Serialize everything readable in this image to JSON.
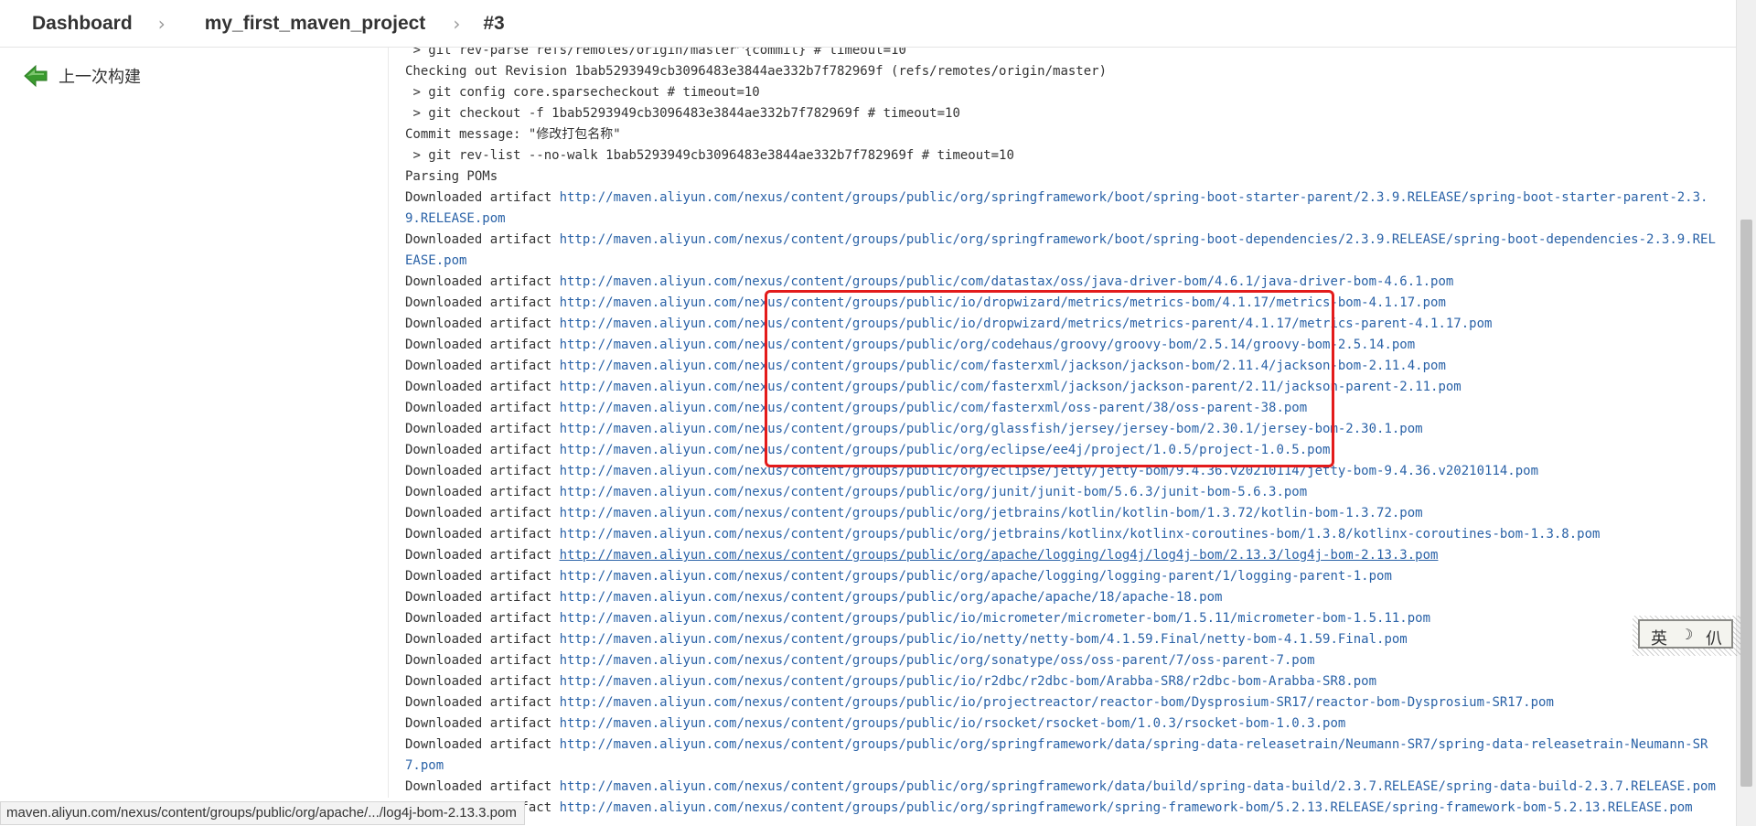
{
  "breadcrumbs": {
    "dashboard": "Dashboard",
    "project": "my_first_maven_project",
    "build": "#3",
    "separator": "›"
  },
  "sidebar": {
    "previous_build": "上一次构建",
    "previous_build_icon": "green-back-arrow"
  },
  "console": {
    "artifact_prefix": "Downloaded artifact ",
    "lines": [
      {
        "text": " > git rev-parse refs/remotes/origin/master^{commit} # timeout=10"
      },
      {
        "text": "Checking out Revision 1bab5293949cb3096483e3844ae332b7f782969f (refs/remotes/origin/master)"
      },
      {
        "text": " > git config core.sparsecheckout # timeout=10"
      },
      {
        "text": " > git checkout -f 1bab5293949cb3096483e3844ae332b7f782969f # timeout=10"
      },
      {
        "text": "Commit message: \"修改打包名称\""
      },
      {
        "text": " > git rev-list --no-walk 1bab5293949cb3096483e3844ae332b7f782969f # timeout=10"
      },
      {
        "text": "Parsing POMs"
      },
      {
        "url": "http://maven.aliyun.com/nexus/content/groups/public/org/springframework/boot/spring-boot-starter-parent/2.3.9.RELEASE/spring-boot-starter-parent-2.3.9.RELEASE.pom"
      },
      {
        "url": "http://maven.aliyun.com/nexus/content/groups/public/org/springframework/boot/spring-boot-dependencies/2.3.9.RELEASE/spring-boot-dependencies-2.3.9.RELEASE.pom"
      },
      {
        "url": "http://maven.aliyun.com/nexus/content/groups/public/com/datastax/oss/java-driver-bom/4.6.1/java-driver-bom-4.6.1.pom"
      },
      {
        "url": "http://maven.aliyun.com/nexus/content/groups/public/io/dropwizard/metrics/metrics-bom/4.1.17/metrics-bom-4.1.17.pom"
      },
      {
        "url": "http://maven.aliyun.com/nexus/content/groups/public/io/dropwizard/metrics/metrics-parent/4.1.17/metrics-parent-4.1.17.pom"
      },
      {
        "url": "http://maven.aliyun.com/nexus/content/groups/public/org/codehaus/groovy/groovy-bom/2.5.14/groovy-bom-2.5.14.pom"
      },
      {
        "url": "http://maven.aliyun.com/nexus/content/groups/public/com/fasterxml/jackson/jackson-bom/2.11.4/jackson-bom-2.11.4.pom"
      },
      {
        "url": "http://maven.aliyun.com/nexus/content/groups/public/com/fasterxml/jackson/jackson-parent/2.11/jackson-parent-2.11.pom"
      },
      {
        "url": "http://maven.aliyun.com/nexus/content/groups/public/com/fasterxml/oss-parent/38/oss-parent-38.pom"
      },
      {
        "url": "http://maven.aliyun.com/nexus/content/groups/public/org/glassfish/jersey/jersey-bom/2.30.1/jersey-bom-2.30.1.pom"
      },
      {
        "url": "http://maven.aliyun.com/nexus/content/groups/public/org/eclipse/ee4j/project/1.0.5/project-1.0.5.pom"
      },
      {
        "url": "http://maven.aliyun.com/nexus/content/groups/public/org/eclipse/jetty/jetty-bom/9.4.36.v20210114/jetty-bom-9.4.36.v20210114.pom"
      },
      {
        "url": "http://maven.aliyun.com/nexus/content/groups/public/org/junit/junit-bom/5.6.3/junit-bom-5.6.3.pom"
      },
      {
        "url": "http://maven.aliyun.com/nexus/content/groups/public/org/jetbrains/kotlin/kotlin-bom/1.3.72/kotlin-bom-1.3.72.pom"
      },
      {
        "url": "http://maven.aliyun.com/nexus/content/groups/public/org/jetbrains/kotlinx/kotlinx-coroutines-bom/1.3.8/kotlinx-coroutines-bom-1.3.8.pom"
      },
      {
        "url": "http://maven.aliyun.com/nexus/content/groups/public/org/apache/logging/log4j/log4j-bom/2.13.3/log4j-bom-2.13.3.pom",
        "hover": true
      },
      {
        "url": "http://maven.aliyun.com/nexus/content/groups/public/org/apache/logging/logging-parent/1/logging-parent-1.pom"
      },
      {
        "url": "http://maven.aliyun.com/nexus/content/groups/public/org/apache/apache/18/apache-18.pom"
      },
      {
        "url": "http://maven.aliyun.com/nexus/content/groups/public/io/micrometer/micrometer-bom/1.5.11/micrometer-bom-1.5.11.pom"
      },
      {
        "url": "http://maven.aliyun.com/nexus/content/groups/public/io/netty/netty-bom/4.1.59.Final/netty-bom-4.1.59.Final.pom"
      },
      {
        "url": "http://maven.aliyun.com/nexus/content/groups/public/org/sonatype/oss/oss-parent/7/oss-parent-7.pom"
      },
      {
        "url": "http://maven.aliyun.com/nexus/content/groups/public/io/r2dbc/r2dbc-bom/Arabba-SR8/r2dbc-bom-Arabba-SR8.pom"
      },
      {
        "url": "http://maven.aliyun.com/nexus/content/groups/public/io/projectreactor/reactor-bom/Dysprosium-SR17/reactor-bom-Dysprosium-SR17.pom"
      },
      {
        "url": "http://maven.aliyun.com/nexus/content/groups/public/io/rsocket/rsocket-bom/1.0.3/rsocket-bom-1.0.3.pom"
      },
      {
        "url": "http://maven.aliyun.com/nexus/content/groups/public/org/springframework/data/spring-data-releasetrain/Neumann-SR7/spring-data-releasetrain-Neumann-SR7.pom"
      },
      {
        "url": "http://maven.aliyun.com/nexus/content/groups/public/org/springframework/data/build/spring-data-build/2.3.7.RELEASE/spring-data-build-2.3.7.RELEASE.pom"
      },
      {
        "url": "http://maven.aliyun.com/nexus/content/groups/public/org/springframework/spring-framework-bom/5.2.13.RELEASE/spring-framework-bom-5.2.13.RELEASE.pom"
      }
    ]
  },
  "status_bar": {
    "url": "maven.aliyun.com/nexus/content/groups/public/org/apache/.../log4j-bom-2.13.3.pom"
  },
  "ime_toolbar": {
    "mode": "英",
    "moon": "☽",
    "width": "仈"
  },
  "colors": {
    "link": "#2a62a7",
    "highlight_border": "#e31b1b",
    "text": "#333333",
    "back_arrow": "#3a9a2f"
  }
}
